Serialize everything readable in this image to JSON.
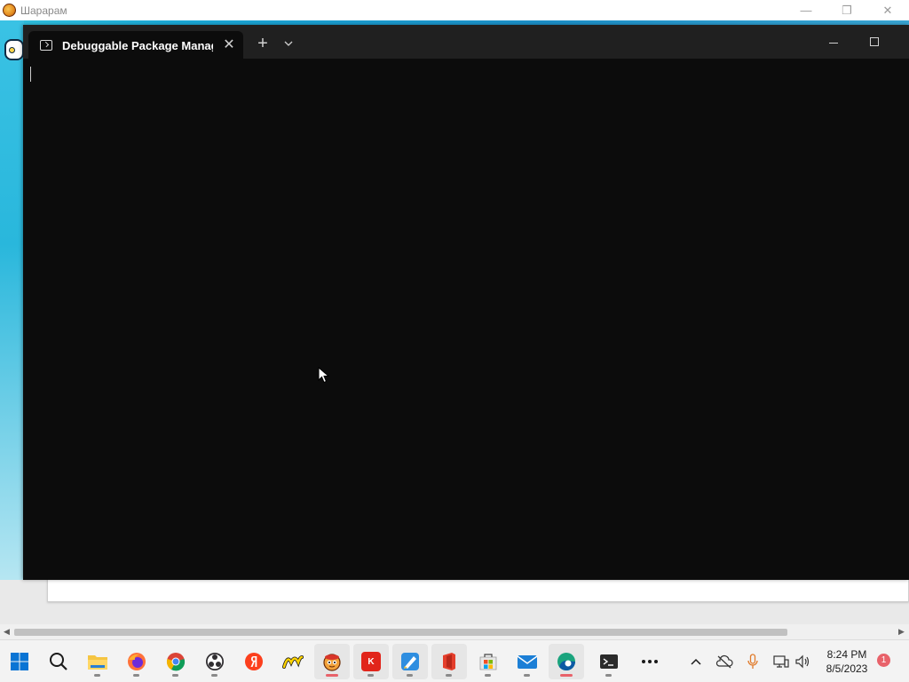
{
  "background_window": {
    "title": "Шарарам",
    "min_label": "—",
    "restore_label": "❐",
    "close_label": "✕",
    "scroll_left": "◀",
    "scroll_right": "▶"
  },
  "terminal": {
    "tab_title": "Debuggable Package Manage",
    "tab_close": "✕",
    "new_tab": "+",
    "colors": {
      "background": "#0c0c0c",
      "tabbar": "#202020"
    }
  },
  "taskbar": {
    "apps": [
      {
        "name": "start-button",
        "icon": "windows-logo-icon"
      },
      {
        "name": "search-button",
        "icon": "search-icon"
      },
      {
        "name": "file-explorer",
        "icon": "folder-icon"
      },
      {
        "name": "firefox",
        "icon": "firefox-icon"
      },
      {
        "name": "chrome",
        "icon": "chrome-icon"
      },
      {
        "name": "obs-studio",
        "icon": "obs-icon"
      },
      {
        "name": "yandex-browser",
        "icon": "yandex-icon"
      },
      {
        "name": "yandex-market",
        "icon": "yandex-market-icon"
      },
      {
        "name": "shararam",
        "icon": "shararam-icon"
      },
      {
        "name": "kinopoisk",
        "icon": "kinopoisk-icon"
      },
      {
        "name": "paint-app",
        "icon": "paint-icon"
      },
      {
        "name": "office",
        "icon": "office-icon"
      },
      {
        "name": "microsoft-store",
        "icon": "store-icon"
      },
      {
        "name": "mail",
        "icon": "mail-icon"
      },
      {
        "name": "edge",
        "icon": "edge-icon"
      },
      {
        "name": "terminal",
        "icon": "terminal-icon"
      },
      {
        "name": "more-apps",
        "icon": "ellipsis-icon"
      }
    ],
    "tray": {
      "overflow": "^",
      "time": "8:24 PM",
      "date": "8/5/2023",
      "notifications": "1"
    }
  }
}
